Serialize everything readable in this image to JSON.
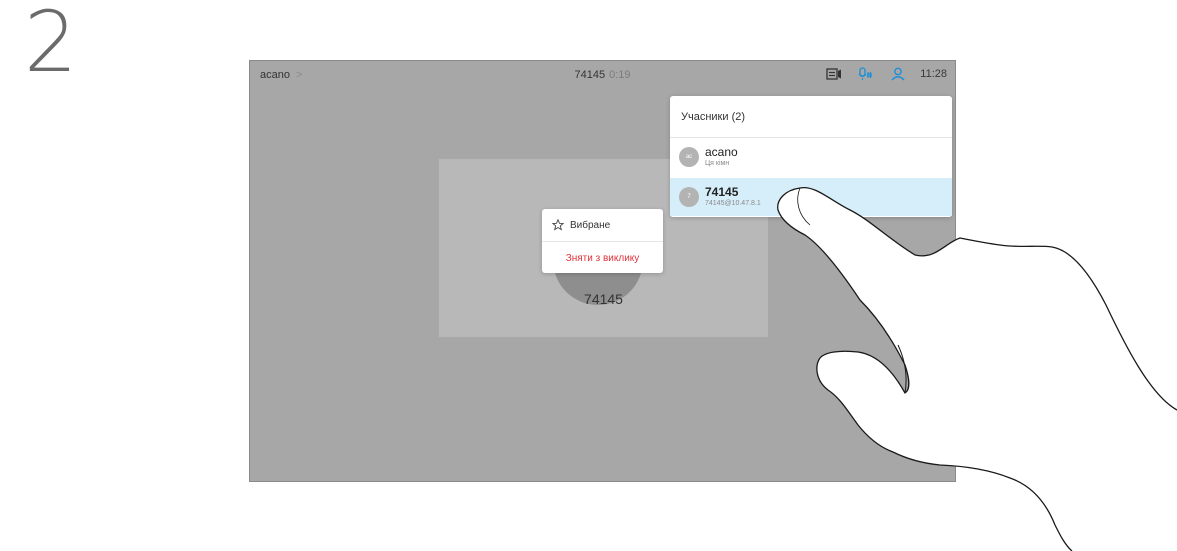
{
  "step": {
    "number": "2"
  },
  "topbar": {
    "room": "acano",
    "call_number": "74145",
    "call_timer": "0:19",
    "clock": "11:28"
  },
  "video": {
    "participant": "74145"
  },
  "context_menu": {
    "favorite_label": "Вибране",
    "remove_label": "Зняти з виклику"
  },
  "participants_panel": {
    "title": "Учасники (2)",
    "items": [
      {
        "initials": "ac",
        "name": "acano",
        "subtitle": "Ця кімн"
      },
      {
        "initials": "7",
        "name": "74145",
        "subtitle": "74145@10.47.8.1"
      }
    ]
  },
  "icons": [
    "chevron-right-icon",
    "screen-share-icon",
    "microphone-icon",
    "participants-icon",
    "star-icon"
  ],
  "colors": {
    "accent": "#1d8fd6",
    "danger": "#e0333a",
    "selected_row": "#d6eef9",
    "screen_bg": "#a7a7a7"
  }
}
